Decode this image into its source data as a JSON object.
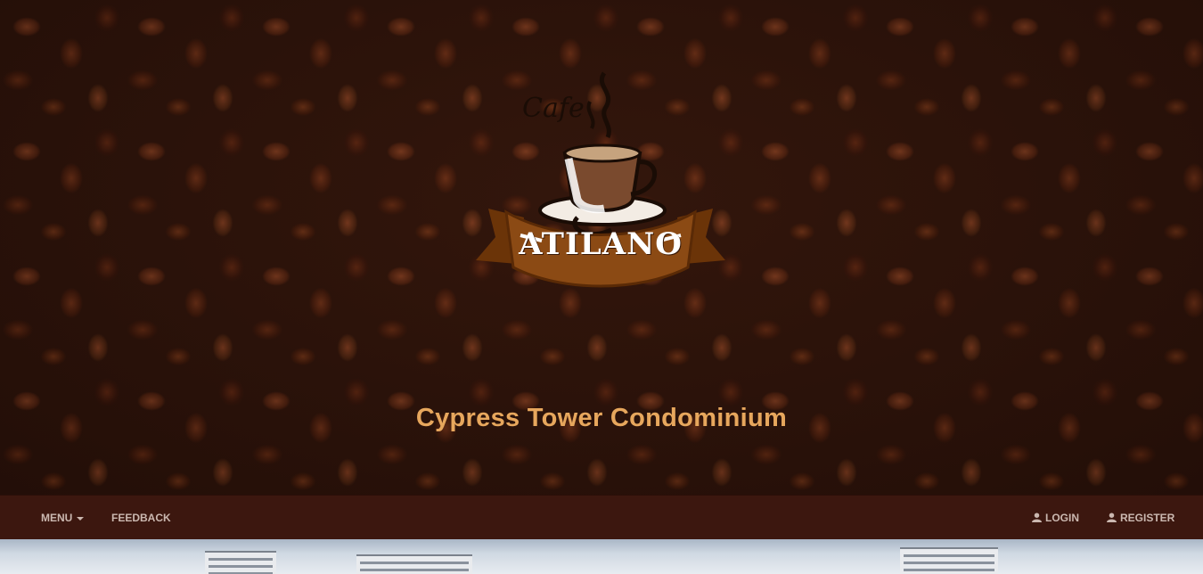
{
  "hero": {
    "logo": {
      "script_text": "Cafe",
      "brand_name": "ATILANO"
    },
    "subtitle": "Cypress Tower Condominium"
  },
  "navbar": {
    "left": [
      {
        "label": "MENU",
        "dropdown": true
      },
      {
        "label": "FEEDBACK",
        "dropdown": false
      }
    ],
    "right": [
      {
        "label": "LOGIN",
        "icon": "user-icon"
      },
      {
        "label": "REGISTER",
        "icon": "user-icon"
      }
    ]
  },
  "colors": {
    "hero_background": "#2b120a",
    "subtitle": "#e7a75d",
    "navbar_background": "#3c170f",
    "nav_text": "#cbb8b0",
    "ribbon": "#8b4a14"
  }
}
